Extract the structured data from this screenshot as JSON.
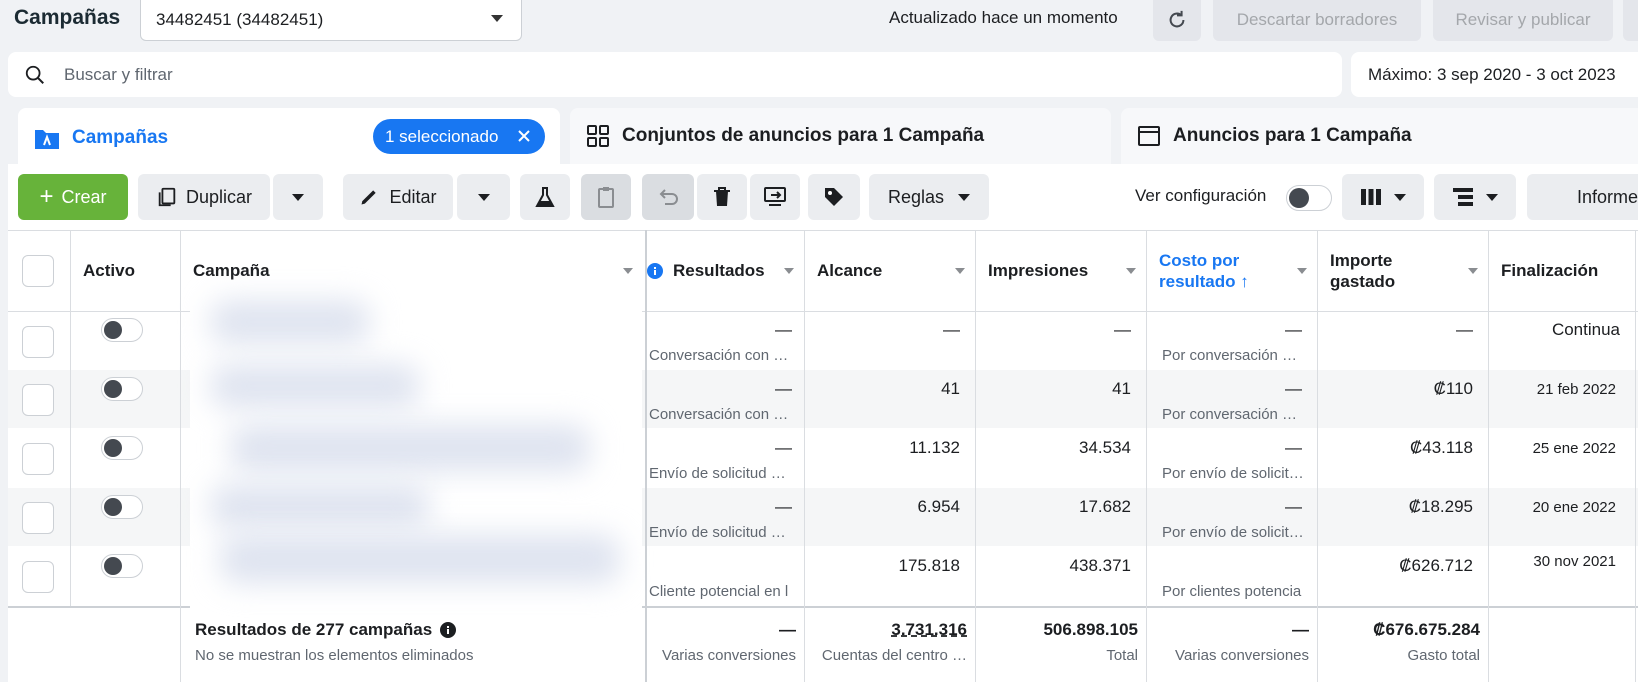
{
  "header": {
    "title": "Campañas",
    "account": "34482451 (34482451)",
    "updated": "Actualizado hace un momento",
    "discard_label": "Descartar borradores",
    "review_label": "Revisar y publicar"
  },
  "search": {
    "placeholder": "Buscar y filtrar",
    "date_range": "Máximo: 3 sep 2020 - 3 oct 2023"
  },
  "tabs": {
    "campaigns": "Campañas",
    "selected_pill": "1 seleccionado",
    "adsets": "Conjuntos de anuncios para 1 Campaña",
    "ads": "Anuncios para 1 Campaña"
  },
  "toolbar": {
    "create": "Crear",
    "duplicate": "Duplicar",
    "edit": "Editar",
    "rules": "Reglas",
    "view_config": "Ver configuración",
    "reports": "Informes"
  },
  "columns": {
    "active": "Activo",
    "campaign": "Campaña",
    "results": "Resultados",
    "reach": "Alcance",
    "impressions": "Impresiones",
    "cost_per_result": "Costo por resultado ↑",
    "amount_spent_line1": "Importe",
    "amount_spent_line2": "gastado",
    "ends": "Finalización"
  },
  "rows": [
    {
      "result": "—",
      "result_sub": "Conversación con …",
      "reach": "—",
      "impressions": "—",
      "cost": "—",
      "cost_sub": "Por conversación …",
      "spent": "—",
      "ends": "Continua"
    },
    {
      "result": "—",
      "result_sub": "Conversación con …",
      "reach": "41",
      "impressions": "41",
      "cost": "—",
      "cost_sub": "Por conversación …",
      "spent": "₡110",
      "ends": "21 feb 2022"
    },
    {
      "result": "—",
      "result_sub": "Envío de solicitud …",
      "reach": "11.132",
      "impressions": "34.534",
      "cost": "—",
      "cost_sub": "Por envío de solicit…",
      "spent": "₡43.118",
      "ends": "25 ene 2022"
    },
    {
      "result": "—",
      "result_sub": "Envío de solicitud …",
      "reach": "6.954",
      "impressions": "17.682",
      "cost": "—",
      "cost_sub": "Por envío de solicit…",
      "spent": "₡18.295",
      "ends": "20 ene 2022"
    },
    {
      "result": "",
      "result_sub": "Cliente potencial en l",
      "reach": "175.818",
      "impressions": "438.371",
      "cost": "",
      "cost_sub": "Por clientes potencia",
      "spent": "₡626.712",
      "ends": "30 nov 2021"
    }
  ],
  "footer": {
    "title": "Resultados de 277 campañas",
    "subtitle": "No se muestran los elementos eliminados",
    "results": "—",
    "results_label": "Varias conversiones",
    "reach": "3.731.316",
    "reach_label": "Cuentas del centro …",
    "impressions": "506.898.105",
    "impressions_label": "Total",
    "cost": "—",
    "cost_label": "Varias conversiones",
    "spent": "₡676.675.284",
    "spent_label": "Gasto total"
  },
  "colors": {
    "accent": "#1877f2",
    "create": "#67b33a"
  }
}
